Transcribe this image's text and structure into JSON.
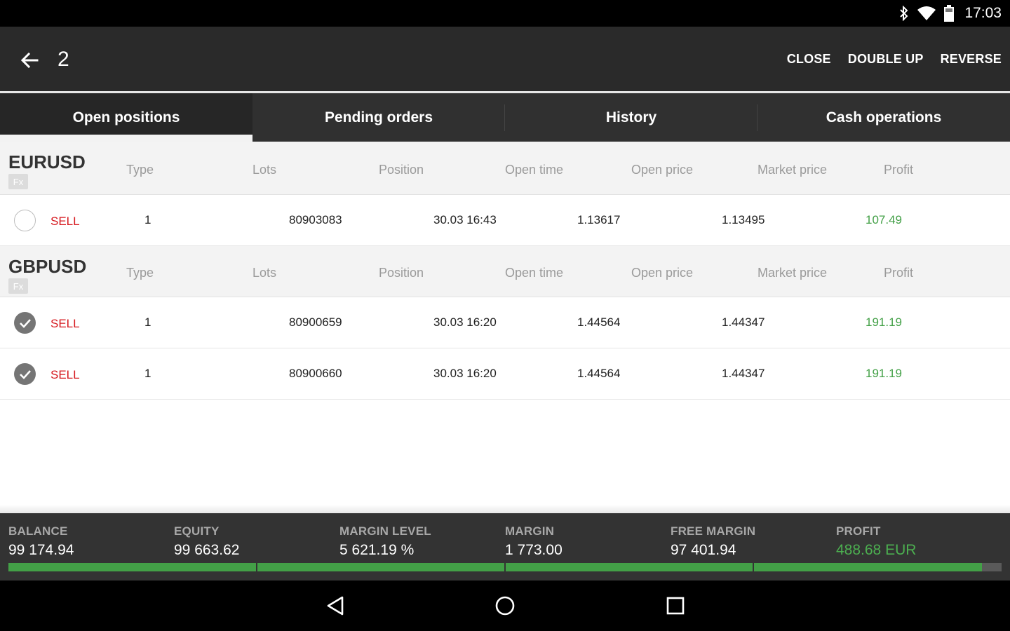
{
  "status_bar": {
    "time": "17:03",
    "icons": [
      "bluetooth-icon",
      "wifi-icon",
      "battery-icon"
    ]
  },
  "app_bar": {
    "title": "2",
    "actions": {
      "close": "CLOSE",
      "double_up": "DOUBLE UP",
      "reverse": "REVERSE"
    }
  },
  "tabs": [
    {
      "label": "Open positions",
      "active": true
    },
    {
      "label": "Pending orders",
      "active": false
    },
    {
      "label": "History",
      "active": false
    },
    {
      "label": "Cash operations",
      "active": false
    }
  ],
  "columns": {
    "type": "Type",
    "lots": "Lots",
    "position": "Position",
    "open_time": "Open time",
    "open_price": "Open price",
    "market_price": "Market price",
    "profit": "Profit"
  },
  "groups": [
    {
      "symbol": "EURUSD",
      "badge": "Fx",
      "rows": [
        {
          "selected": false,
          "type": "SELL",
          "lots": "1",
          "position": "80903083",
          "open_time": "30.03 16:43",
          "open_price": "1.13617",
          "market_price": "1.13495",
          "profit": "107.49"
        }
      ]
    },
    {
      "symbol": "GBPUSD",
      "badge": "Fx",
      "rows": [
        {
          "selected": true,
          "type": "SELL",
          "lots": "1",
          "position": "80900659",
          "open_time": "30.03 16:20",
          "open_price": "1.44564",
          "market_price": "1.44347",
          "profit": "191.19"
        },
        {
          "selected": true,
          "type": "SELL",
          "lots": "1",
          "position": "80900660",
          "open_time": "30.03 16:20",
          "open_price": "1.44564",
          "market_price": "1.44347",
          "profit": "191.19"
        }
      ]
    }
  ],
  "summary": {
    "balance": {
      "label": "BALANCE",
      "value": "99 174.94"
    },
    "equity": {
      "label": "EQUITY",
      "value": "99 663.62"
    },
    "margin_level": {
      "label": "MARGIN LEVEL",
      "value": "5 621.19 %"
    },
    "margin": {
      "label": "MARGIN",
      "value": "1 773.00"
    },
    "free_margin": {
      "label": "FREE MARGIN",
      "value": "97 401.94"
    },
    "profit": {
      "label": "PROFIT",
      "value": "488.68 EUR"
    },
    "progress_fraction": 0.98
  },
  "colors": {
    "sell": "#d6181e",
    "profit": "#43a047",
    "appbar": "#2a2a2a",
    "tabs": "#303030",
    "summary": "#333333"
  },
  "nav_bar": {
    "icons": [
      "back-triangle-icon",
      "home-circle-icon",
      "recents-square-icon"
    ]
  }
}
